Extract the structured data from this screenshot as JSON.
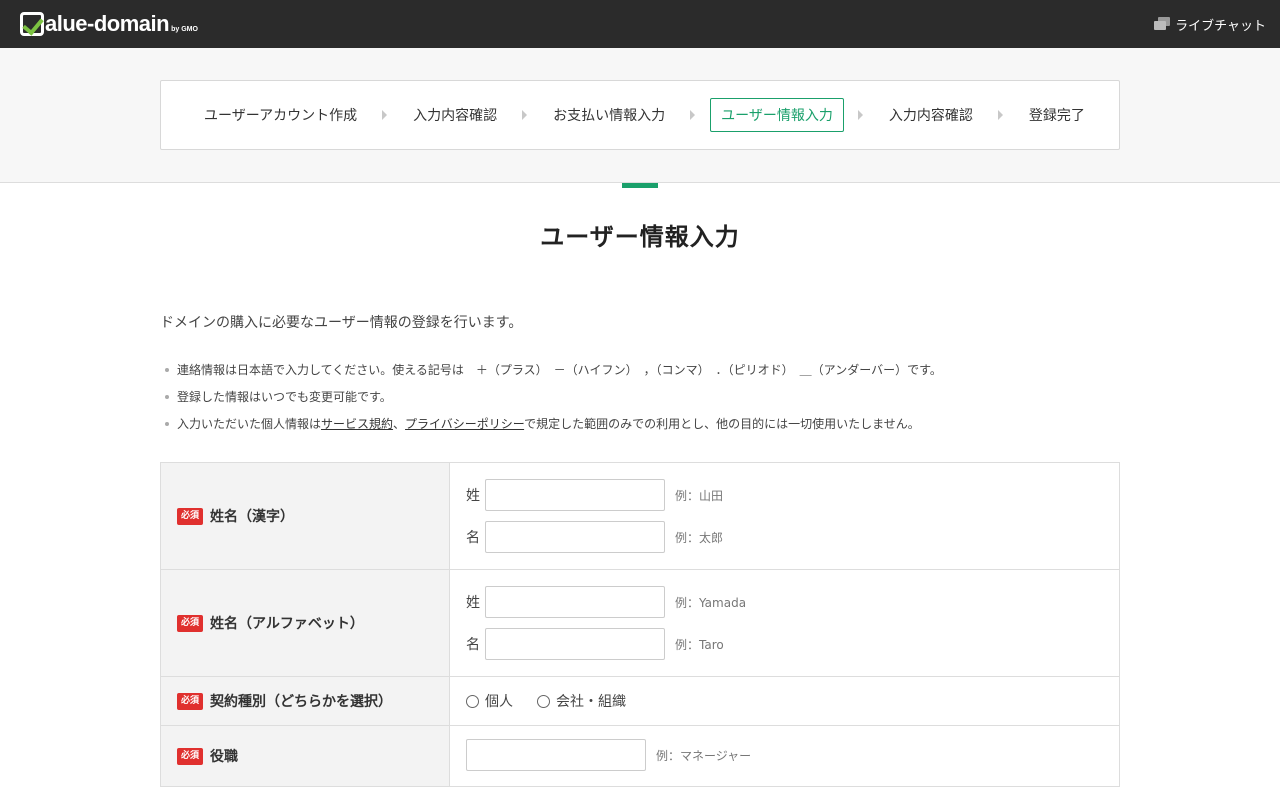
{
  "header": {
    "logo_text": "alue-domain",
    "logo_sub": "by GMO",
    "chat_label": "ライブチャット"
  },
  "steps": [
    {
      "label": "ユーザーアカウント作成"
    },
    {
      "label": "入力内容確認"
    },
    {
      "label": "お支払い情報入力"
    },
    {
      "label": "ユーザー情報入力"
    },
    {
      "label": "入力内容確認"
    },
    {
      "label": "登録完了"
    }
  ],
  "page_title": "ユーザー情報入力",
  "intro": "ドメインの購入に必要なユーザー情報の登録を行います。",
  "notes": {
    "n1": "連絡情報は日本語で入力してください。使える記号は　＋（プラス）　－（ハイフン）　，（コンマ）　．（ピリオド）　＿（アンダーバー）です。",
    "n2": "登録した情報はいつでも変更可能です。",
    "n3_prefix": "入力いただいた個人情報は",
    "n3_link1": "サービス規約",
    "n3_mid": "、",
    "n3_link2": "プライバシーポリシー",
    "n3_suffix": "で規定した範囲のみでの利用とし、他の目的には一切使用いたしません。"
  },
  "form": {
    "required_badge": "必須",
    "name_kanji": {
      "label": "姓名（漢字）",
      "sei": "姓",
      "sei_example": "例：山田",
      "mei": "名",
      "mei_example": "例：太郎"
    },
    "name_alpha": {
      "label": "姓名（アルファベット）",
      "sei": "姓",
      "sei_example": "例：Yamada",
      "mei": "名",
      "mei_example": "例：Taro"
    },
    "contract": {
      "label": "契約種別（どちらかを選択）",
      "option_personal": "個人",
      "option_org": "会社・組織"
    },
    "position": {
      "label": "役職",
      "example": "例：マネージャー"
    }
  }
}
